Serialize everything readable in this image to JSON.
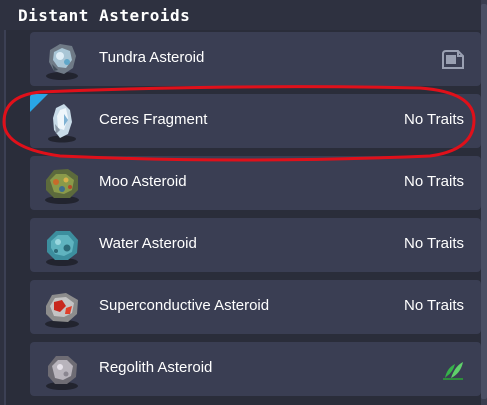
{
  "panel": {
    "title": "Distant Asteroids"
  },
  "asteroids": [
    {
      "name": "Tundra Asteroid",
      "trait": "",
      "trait_icon": "rocket-launch-icon",
      "icon": "tundra-asteroid-icon"
    },
    {
      "name": "Ceres Fragment",
      "trait": "No Traits",
      "trait_icon": "",
      "icon": "ceres-fragment-icon"
    },
    {
      "name": "Moo Asteroid",
      "trait": "No Traits",
      "trait_icon": "",
      "icon": "moo-asteroid-icon"
    },
    {
      "name": "Water Asteroid",
      "trait": "No Traits",
      "trait_icon": "",
      "icon": "water-asteroid-icon"
    },
    {
      "name": "Superconductive Asteroid",
      "trait": "No Traits",
      "trait_icon": "",
      "icon": "superconductive-asteroid-icon"
    },
    {
      "name": "Regolith Asteroid",
      "trait": "",
      "trait_icon": "plant-icon",
      "icon": "regolith-asteroid-icon"
    }
  ],
  "selected_index": 1,
  "colors": {
    "accent": "#29a6e6",
    "annotation": "#e0101a",
    "row_bg": "#3a3e53",
    "panel_bg": "#2e3140"
  }
}
